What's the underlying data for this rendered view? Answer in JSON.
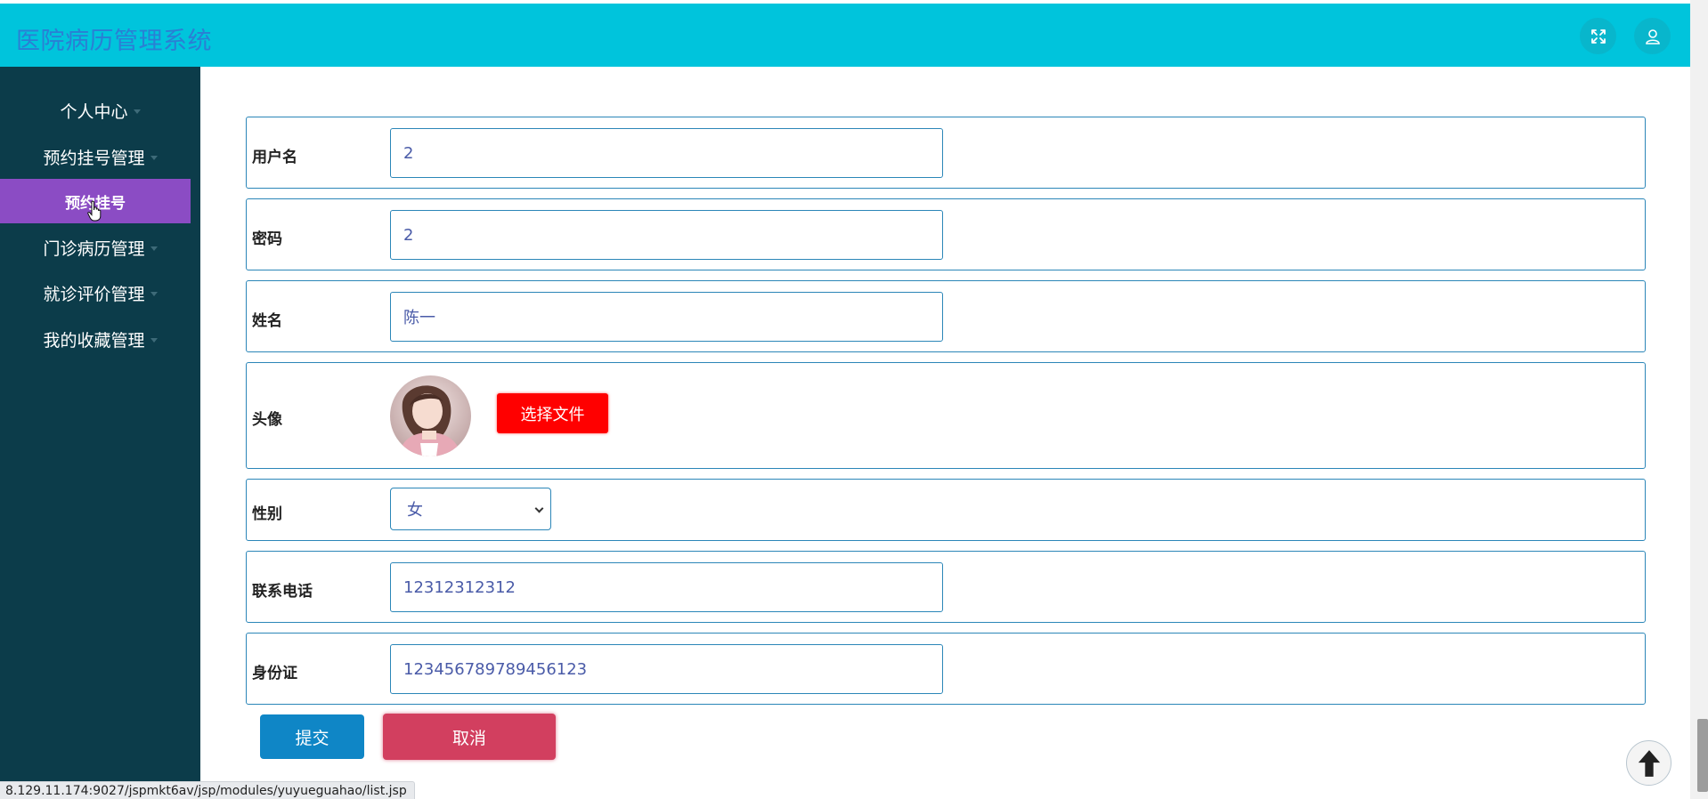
{
  "header": {
    "title": "医院病历管理系统",
    "fullscreen_icon": "expand-arrows-icon",
    "user_icon": "user-icon"
  },
  "sidebar": {
    "items": [
      {
        "label": "个人中心"
      },
      {
        "label": "预约挂号管理"
      },
      {
        "label": "门诊病历管理"
      },
      {
        "label": "就诊评价管理"
      },
      {
        "label": "我的收藏管理"
      }
    ],
    "active_sub": "预约挂号"
  },
  "form": {
    "username": {
      "label": "用户名",
      "value": "2"
    },
    "password": {
      "label": "密码",
      "value": "2"
    },
    "name": {
      "label": "姓名",
      "value": "陈一"
    },
    "avatar": {
      "label": "头像",
      "button": "选择文件"
    },
    "gender": {
      "label": "性别",
      "value": "女"
    },
    "phone": {
      "label": "联系电话",
      "value": "12312312312"
    },
    "idcard": {
      "label": "身份证",
      "value": "123456789789456123"
    }
  },
  "actions": {
    "submit": "提交",
    "cancel": "取消"
  },
  "status_bar": {
    "url": "8.129.11.174:9027/jspmkt6av/jsp/modules/yuyueguahao/list.jsp"
  },
  "colors": {
    "header_bg": "#00c4dc",
    "sidebar_bg": "#0c3c4a",
    "active_item": "#8b4cc4",
    "submit": "#0f86c6",
    "cancel": "#d23f5f",
    "file_button": "#ff0000"
  }
}
